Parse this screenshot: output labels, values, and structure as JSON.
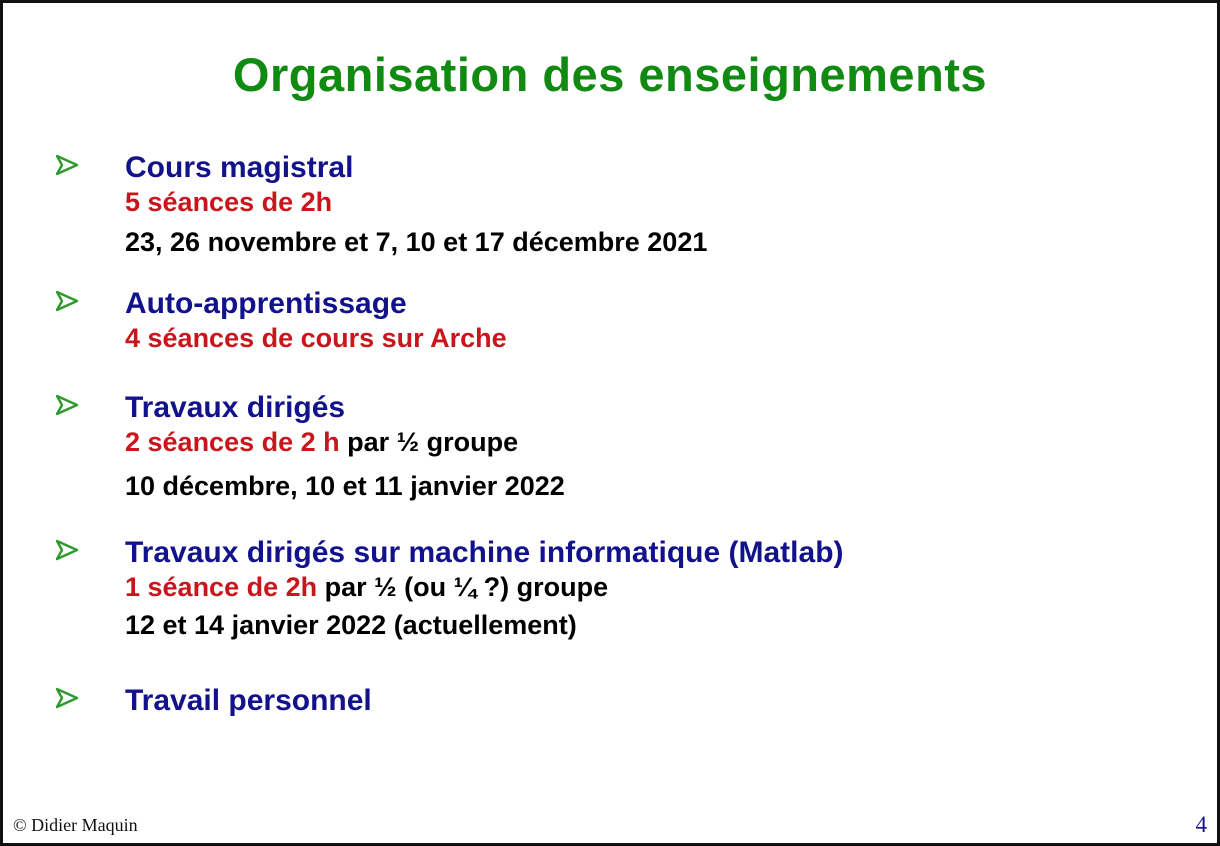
{
  "title": "Organisation des enseignements",
  "items": [
    {
      "heading": "Cours magistral",
      "line1_red": "5 séances de 2h",
      "line2": "23, 26 novembre et 7, 10 et 17 décembre 2021"
    },
    {
      "heading": "Auto-apprentissage",
      "line1_red": "4 séances de cours sur Arche"
    },
    {
      "heading": "Travaux dirigés",
      "line1_red": "2 séances de 2 h",
      "line1_black": " par ½ groupe",
      "line2": "10 décembre, 10 et 11 janvier 2022"
    },
    {
      "heading": "Travaux dirigés sur machine informatique (Matlab)",
      "line1_red": "1 séance de 2h",
      "line1_black": " par ½  (ou ¼ ?)  groupe",
      "line2": "12 et 14 janvier 2022 (actuellement)"
    },
    {
      "heading": "Travail personnel"
    }
  ],
  "footer": {
    "copyright": "© Didier Maquin",
    "page_number": "4"
  },
  "colors": {
    "title": "#118a11",
    "heading": "#12128c",
    "highlight": "#c8161c",
    "bullet": "#2e9a2e"
  },
  "bullet_icon": "arrow-bullet-icon"
}
